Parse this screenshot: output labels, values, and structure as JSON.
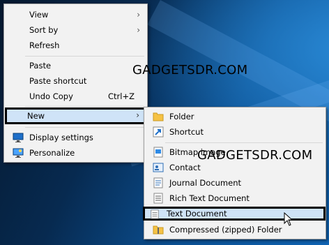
{
  "main_menu": {
    "items": [
      {
        "label": "View",
        "submenu": true
      },
      {
        "label": "Sort by",
        "submenu": true
      },
      {
        "label": "Refresh"
      },
      {
        "label": "Paste"
      },
      {
        "label": "Paste shortcut"
      },
      {
        "label": "Undo Copy",
        "shortcut": "Ctrl+Z"
      },
      {
        "label": "New",
        "submenu": true,
        "highlighted": true
      },
      {
        "label": "Display settings",
        "icon": "display-settings-icon"
      },
      {
        "label": "Personalize",
        "icon": "personalize-icon"
      }
    ],
    "chevron": "›"
  },
  "new_submenu": {
    "items": [
      {
        "label": "Folder",
        "icon": "folder-icon"
      },
      {
        "label": "Shortcut",
        "icon": "shortcut-icon"
      },
      {
        "label": "Bitmap image",
        "icon": "bitmap-image-icon"
      },
      {
        "label": "Contact",
        "icon": "contact-icon"
      },
      {
        "label": "Journal Document",
        "icon": "journal-document-icon"
      },
      {
        "label": "Rich Text Document",
        "icon": "rich-text-document-icon"
      },
      {
        "label": "Text Document",
        "icon": "text-document-icon",
        "highlighted": true
      },
      {
        "label": "Compressed (zipped) Folder",
        "icon": "zip-folder-icon"
      }
    ]
  },
  "watermarks": [
    "GADGETSDR.COM",
    "GADGETSDR.COM"
  ],
  "colors": {
    "menu_bg": "#f2f2f2",
    "highlight": "#cfe3f7",
    "highlight_border": "#000000",
    "desktop": "#0b4f91"
  }
}
